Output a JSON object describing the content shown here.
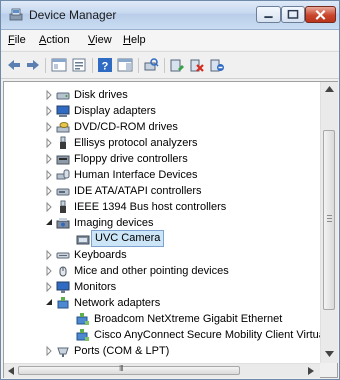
{
  "window": {
    "title": "Device Manager"
  },
  "menu": [
    {
      "label": "File",
      "key": "F",
      "rest": "ile"
    },
    {
      "label": "Action",
      "key": "A",
      "rest": "ction"
    },
    {
      "label": "View",
      "key": "V",
      "rest": "iew"
    },
    {
      "label": "Help",
      "key": "H",
      "rest": "elp"
    }
  ],
  "toolbar": [
    "back-icon",
    "forward-icon",
    "show-hide-console-tree-icon",
    "properties-icon",
    "help-icon",
    "show-action-pane-icon",
    "scan-hardware-icon",
    "update-driver-icon",
    "uninstall-device-icon",
    "disable-device-icon"
  ],
  "tree": [
    {
      "label": "Disk drives",
      "state": "collapsed",
      "icon": "disk-drive-icon"
    },
    {
      "label": "Display adapters",
      "state": "collapsed",
      "icon": "display-adapter-icon"
    },
    {
      "label": "DVD/CD-ROM drives",
      "state": "collapsed",
      "icon": "dvd-drive-icon"
    },
    {
      "label": "Ellisys protocol analyzers",
      "state": "collapsed",
      "icon": "usb-plug-icon"
    },
    {
      "label": "Floppy drive controllers",
      "state": "collapsed",
      "icon": "floppy-controller-icon"
    },
    {
      "label": "Human Interface Devices",
      "state": "collapsed",
      "icon": "hid-icon"
    },
    {
      "label": "IDE ATA/ATAPI controllers",
      "state": "collapsed",
      "icon": "ide-controller-icon"
    },
    {
      "label": "IEEE 1394 Bus host controllers",
      "state": "collapsed",
      "icon": "usb-plug-icon"
    },
    {
      "label": "Imaging devices",
      "state": "expanded",
      "icon": "imaging-device-icon"
    },
    {
      "label": "UVC Camera",
      "state": "child",
      "icon": "camera-icon",
      "selected": true
    },
    {
      "label": "Keyboards",
      "state": "collapsed",
      "icon": "keyboard-icon"
    },
    {
      "label": "Mice and other pointing devices",
      "state": "collapsed",
      "icon": "mouse-icon"
    },
    {
      "label": "Monitors",
      "state": "collapsed",
      "icon": "monitor-icon"
    },
    {
      "label": "Network adapters",
      "state": "expanded",
      "icon": "network-adapter-icon"
    },
    {
      "label": "Broadcom NetXtreme Gigabit Ethernet",
      "state": "child",
      "icon": "network-card-icon"
    },
    {
      "label": "Cisco AnyConnect Secure Mobility Client Virtua",
      "state": "child",
      "icon": "network-card-icon"
    },
    {
      "label": "Ports (COM & LPT)",
      "state": "collapsed",
      "icon": "port-icon"
    }
  ],
  "hscroll": {
    "grip": "III"
  },
  "colors": {
    "selection": "#cde6f7",
    "title_bar": "#c6d8ef",
    "close_button": "#c9462c"
  }
}
